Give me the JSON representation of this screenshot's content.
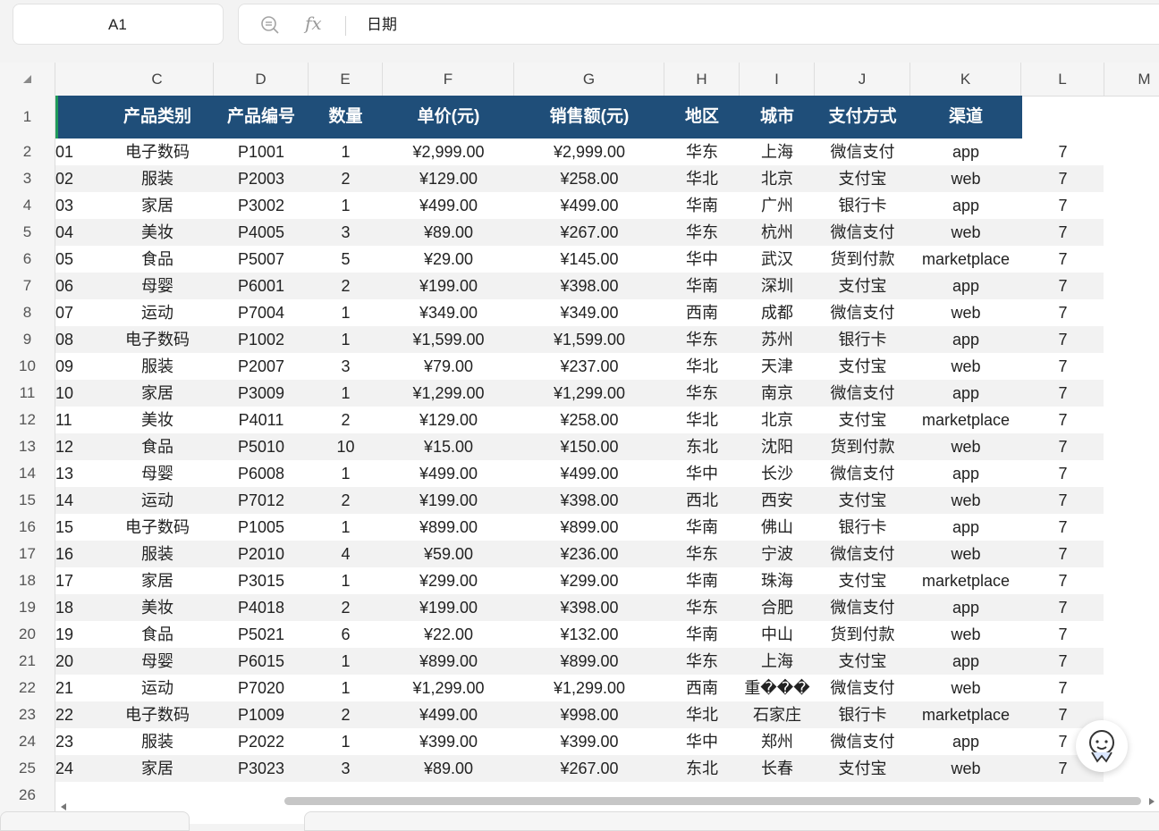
{
  "namebox": {
    "cell_ref": "A1"
  },
  "formula_bar": {
    "content": "日期"
  },
  "columns": [
    "C",
    "D",
    "E",
    "F",
    "G",
    "H",
    "I",
    "J",
    "K",
    "L",
    "M"
  ],
  "row_numbers": [
    "1",
    "2",
    "3",
    "4",
    "5",
    "6",
    "7",
    "8",
    "9",
    "10",
    "11",
    "12",
    "13",
    "14",
    "15",
    "16",
    "17",
    "18",
    "19",
    "20",
    "21",
    "22",
    "23",
    "24",
    "25",
    "26"
  ],
  "header": [
    "产品类别",
    "产品编号",
    "数量",
    "单价(元)",
    "销售额(元)",
    "地区",
    "城市",
    "支付方式",
    "渠道"
  ],
  "rows": [
    [
      "01",
      "电子数码",
      "P1001",
      "1",
      "¥2,999.00",
      "¥2,999.00",
      "华东",
      "上海",
      "微信支付",
      "app",
      "7"
    ],
    [
      "02",
      "服装",
      "P2003",
      "2",
      "¥129.00",
      "¥258.00",
      "华北",
      "北京",
      "支付宝",
      "web",
      "7"
    ],
    [
      "03",
      "家居",
      "P3002",
      "1",
      "¥499.00",
      "¥499.00",
      "华南",
      "广州",
      "银行卡",
      "app",
      "7"
    ],
    [
      "04",
      "美妆",
      "P4005",
      "3",
      "¥89.00",
      "¥267.00",
      "华东",
      "杭州",
      "微信支付",
      "web",
      "7"
    ],
    [
      "05",
      "食品",
      "P5007",
      "5",
      "¥29.00",
      "¥145.00",
      "华中",
      "武汉",
      "货到付款",
      "marketplace",
      "7"
    ],
    [
      "06",
      "母婴",
      "P6001",
      "2",
      "¥199.00",
      "¥398.00",
      "华南",
      "深圳",
      "支付宝",
      "app",
      "7"
    ],
    [
      "07",
      "运动",
      "P7004",
      "1",
      "¥349.00",
      "¥349.00",
      "西南",
      "成都",
      "微信支付",
      "web",
      "7"
    ],
    [
      "08",
      "电子数码",
      "P1002",
      "1",
      "¥1,599.00",
      "¥1,599.00",
      "华东",
      "苏州",
      "银行卡",
      "app",
      "7"
    ],
    [
      "09",
      "服装",
      "P2007",
      "3",
      "¥79.00",
      "¥237.00",
      "华北",
      "天津",
      "支付宝",
      "web",
      "7"
    ],
    [
      "10",
      "家居",
      "P3009",
      "1",
      "¥1,299.00",
      "¥1,299.00",
      "华东",
      "南京",
      "微信支付",
      "app",
      "7"
    ],
    [
      "11",
      "美妆",
      "P4011",
      "2",
      "¥129.00",
      "¥258.00",
      "华北",
      "北京",
      "支付宝",
      "marketplace",
      "7"
    ],
    [
      "12",
      "食品",
      "P5010",
      "10",
      "¥15.00",
      "¥150.00",
      "东北",
      "沈阳",
      "货到付款",
      "web",
      "7"
    ],
    [
      "13",
      "母婴",
      "P6008",
      "1",
      "¥499.00",
      "¥499.00",
      "华中",
      "长沙",
      "微信支付",
      "app",
      "7"
    ],
    [
      "14",
      "运动",
      "P7012",
      "2",
      "¥199.00",
      "¥398.00",
      "西北",
      "西安",
      "支付宝",
      "web",
      "7"
    ],
    [
      "15",
      "电子数码",
      "P1005",
      "1",
      "¥899.00",
      "¥899.00",
      "华南",
      "佛山",
      "银行卡",
      "app",
      "7"
    ],
    [
      "16",
      "服装",
      "P2010",
      "4",
      "¥59.00",
      "¥236.00",
      "华东",
      "宁波",
      "微信支付",
      "web",
      "7"
    ],
    [
      "17",
      "家居",
      "P3015",
      "1",
      "¥299.00",
      "¥299.00",
      "华南",
      "珠海",
      "支付宝",
      "marketplace",
      "7"
    ],
    [
      "18",
      "美妆",
      "P4018",
      "2",
      "¥199.00",
      "¥398.00",
      "华东",
      "合肥",
      "微信支付",
      "app",
      "7"
    ],
    [
      "19",
      "食品",
      "P5021",
      "6",
      "¥22.00",
      "¥132.00",
      "华南",
      "中山",
      "货到付款",
      "web",
      "7"
    ],
    [
      "20",
      "母婴",
      "P6015",
      "1",
      "¥899.00",
      "¥899.00",
      "华东",
      "上海",
      "支付宝",
      "app",
      "7"
    ],
    [
      "21",
      "运动",
      "P7020",
      "1",
      "¥1,299.00",
      "¥1,299.00",
      "西南",
      "重���",
      "微信支付",
      "web",
      "7"
    ],
    [
      "22",
      "电子数码",
      "P1009",
      "2",
      "¥499.00",
      "¥998.00",
      "华北",
      "石家庄",
      "银行卡",
      "marketplace",
      "7"
    ],
    [
      "23",
      "服装",
      "P2022",
      "1",
      "¥399.00",
      "¥399.00",
      "华中",
      "郑州",
      "微信支付",
      "app",
      "7"
    ],
    [
      "24",
      "家居",
      "P3023",
      "3",
      "¥89.00",
      "¥267.00",
      "东北",
      "长春",
      "支付宝",
      "web",
      "7"
    ]
  ],
  "icons": {
    "zoom": "zoom-out-icon",
    "fx": "fx-icon",
    "corner": "select-all-triangle-icon",
    "assistant": "assistant-avatar-icon"
  },
  "colors": {
    "header_band": "#1f4e79",
    "selection_marker": "#1f9a5b",
    "row_alt": "#f2f2f2"
  }
}
